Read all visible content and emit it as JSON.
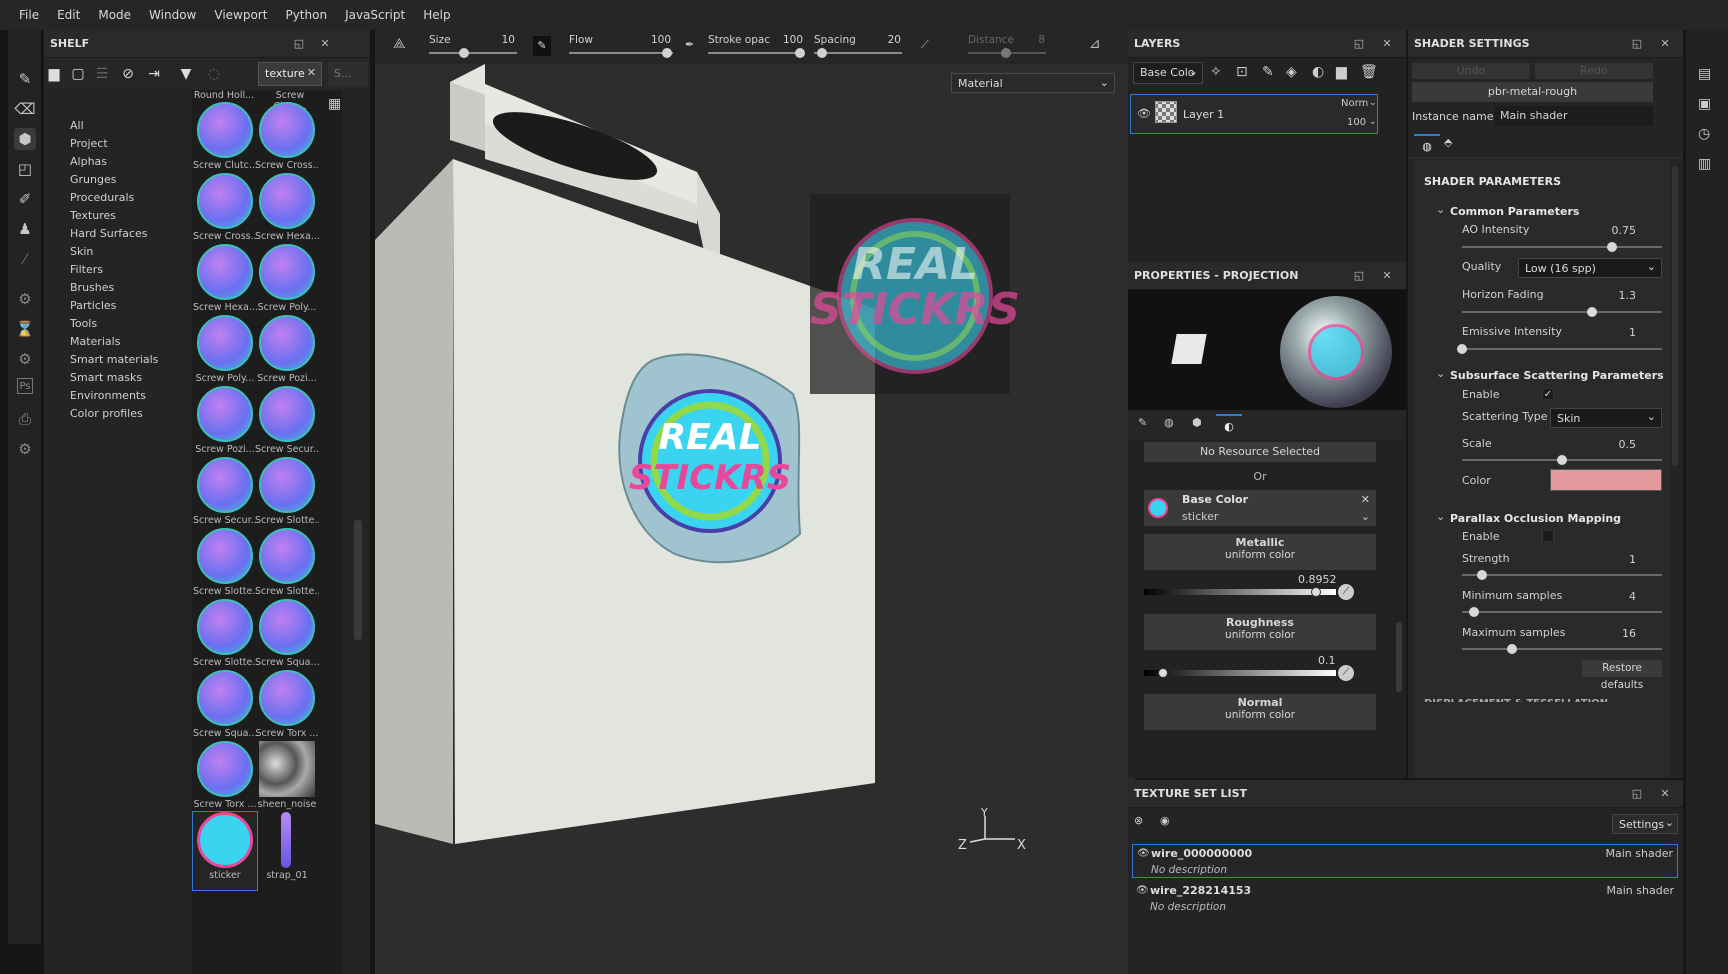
{
  "menu": [
    "File",
    "Edit",
    "Mode",
    "Window",
    "Viewport",
    "Python",
    "JavaScript",
    "Help"
  ],
  "shelf": {
    "title": "SHELF",
    "search_value": "texture",
    "search2_placeholder": "S...",
    "categories": [
      "All",
      "Project",
      "Alphas",
      "Grunges",
      "Procedurals",
      "Textures",
      "Hard Surfaces",
      "Skin",
      "Filters",
      "Brushes",
      "Particles",
      "Tools",
      "Materials",
      "Smart materials",
      "Smart masks",
      "Environments",
      "Color profiles"
    ],
    "top_labels": [
      "Round Holl...",
      "Screw Clutc..."
    ],
    "items": [
      {
        "label": "Screw Clutc..."
      },
      {
        "label": "Screw Cross..."
      },
      {
        "label": "Screw Cross..."
      },
      {
        "label": "Screw Hexa..."
      },
      {
        "label": "Screw Hexa..."
      },
      {
        "label": "Screw Poly..."
      },
      {
        "label": "Screw Poly..."
      },
      {
        "label": "Screw Pozi..."
      },
      {
        "label": "Screw Pozi..."
      },
      {
        "label": "Screw Secur..."
      },
      {
        "label": "Screw Secur..."
      },
      {
        "label": "Screw Slotte..."
      },
      {
        "label": "Screw Slotte..."
      },
      {
        "label": "Screw Slotte..."
      },
      {
        "label": "Screw Slotte..."
      },
      {
        "label": "Screw Squa..."
      },
      {
        "label": "Screw Squa..."
      },
      {
        "label": "Screw Torx ..."
      },
      {
        "label": "Screw Torx ..."
      },
      {
        "label": "sheen_noise"
      },
      {
        "label": "sticker"
      },
      {
        "label": "strap_01"
      }
    ]
  },
  "viewport_toolbar": {
    "size_label": "Size",
    "size_value": "10",
    "flow_label": "Flow",
    "flow_value": "100",
    "stroke_label": "Stroke opac",
    "stroke_value": "100",
    "spacing_label": "Spacing",
    "spacing_value": "20",
    "distance_label": "Distance",
    "distance_value": "8"
  },
  "viewport": {
    "mode_select": "Material",
    "sticker_text_1": "REAL",
    "sticker_text_2": "STICKRS",
    "axis_z": "Z",
    "axis_y": "Y",
    "axis_x": "X"
  },
  "layers": {
    "title": "LAYERS",
    "channel_select": "Base Colo",
    "layer_name": "Layer 1",
    "blend_mode": "Norm",
    "opacity": "100"
  },
  "properties": {
    "title": "PROPERTIES - PROJECTION",
    "no_resource": "No Resource Selected",
    "or": "Or",
    "base_color_label": "Base Color",
    "base_color_value": "sticker",
    "metallic_label": "Metallic",
    "metallic_sub": "uniform color",
    "metallic_value": "0.8952",
    "metallic_fraction": 0.8952,
    "roughness_label": "Roughness",
    "roughness_sub": "uniform color",
    "roughness_value": "0.1",
    "roughness_fraction": 0.1,
    "normal_label": "Normal",
    "normal_sub": "uniform color"
  },
  "shader": {
    "title": "SHADER SETTINGS",
    "undo": "Undo",
    "redo": "Redo",
    "shader_name": "pbr-metal-rough",
    "instance_label": "Instance name",
    "instance_value": "Main shader",
    "params_title": "SHADER PARAMETERS",
    "common_title": "Common Parameters",
    "ao_label": "AO Intensity",
    "ao_value": "0.75",
    "ao_fraction": 0.75,
    "quality_label": "Quality",
    "quality_value": "Low (16 spp)",
    "horizon_label": "Horizon Fading",
    "horizon_value": "1.3",
    "horizon_fraction": 0.65,
    "emissive_label": "Emissive Intensity",
    "emissive_value": "1",
    "emissive_fraction": 0.0,
    "sss_title": "Subsurface Scattering Parameters",
    "sss_enable_label": "Enable",
    "scatter_type_label": "Scattering Type",
    "scatter_type_value": "Skin",
    "scale_label": "Scale",
    "scale_value": "0.5",
    "scale_fraction": 0.5,
    "color_label": "Color",
    "color_swatch": "#e29a9c",
    "pom_title": "Parallax Occlusion Mapping",
    "pom_enable_label": "Enable",
    "strength_label": "Strength",
    "strength_value": "1",
    "strength_fraction": 0.1,
    "min_samples_label": "Minimum samples",
    "min_samples_value": "4",
    "min_samples_fraction": 0.06,
    "max_samples_label": "Maximum samples",
    "max_samples_value": "16",
    "max_samples_fraction": 0.25,
    "restore_defaults": "Restore defaults",
    "cutoff_section": "DISPLACEMENT & TESSELLATION"
  },
  "texture_set_list": {
    "title": "TEXTURE SET LIST",
    "settings": "Settings",
    "sets": [
      {
        "name": "wire_000000000",
        "desc": "No description",
        "shader": "Main shader"
      },
      {
        "name": "wire_228214153",
        "desc": "No description",
        "shader": "Main shader"
      }
    ]
  },
  "colors": {
    "accent": "#2e7bd6",
    "sticker_pink": "#e8489a",
    "sticker_cyan": "#3ad3f0"
  }
}
